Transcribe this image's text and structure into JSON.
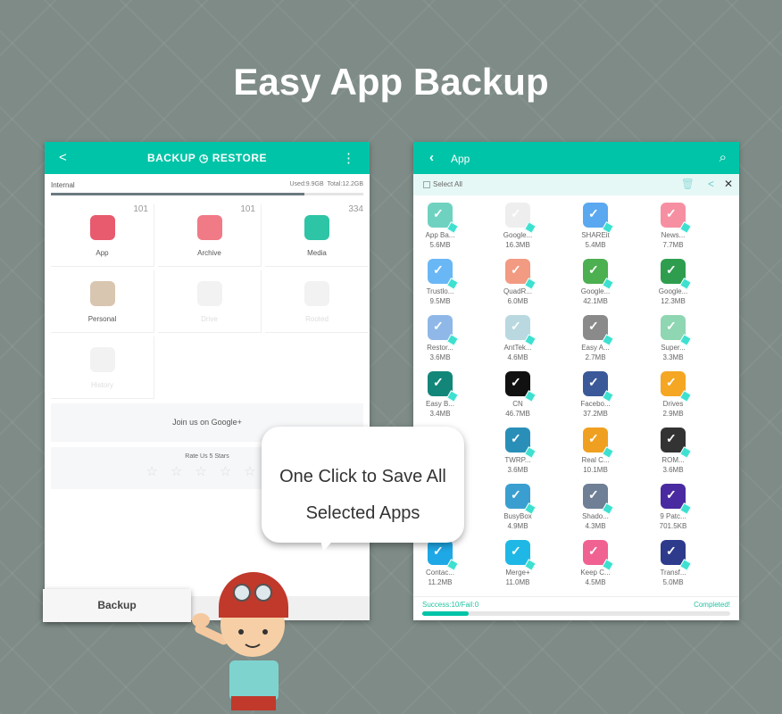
{
  "headline": "Easy App Backup",
  "left": {
    "title": "BACKUP ◷ RESTORE",
    "storage": {
      "label": "Internal",
      "used": "Used:9.9GB",
      "total": "Total:12.2GB",
      "used_fraction": 0.81
    },
    "categories": [
      {
        "label": "App",
        "count": "101",
        "color": "#e85a6e",
        "enabled": true
      },
      {
        "label": "Archive",
        "count": "101",
        "color": "#f07a86",
        "enabled": true
      },
      {
        "label": "Media",
        "count": "334",
        "color": "#2ec4a6",
        "enabled": true
      },
      {
        "label": "Personal",
        "count": "",
        "color": "#d9c6b0",
        "enabled": true
      },
      {
        "label": "Drive",
        "count": "",
        "color": "",
        "enabled": false
      },
      {
        "label": "Rooted",
        "count": "",
        "color": "",
        "enabled": false
      },
      {
        "label": "History",
        "count": "",
        "color": "",
        "enabled": false
      }
    ],
    "google_plus": "Join us on Google+",
    "rate": "Rate Us 5 Stars",
    "stars": "☆☆☆☆☆",
    "backup_button": "Backup"
  },
  "right": {
    "title": "App",
    "select_all": "Select All",
    "apps": [
      {
        "name": "App Ba...",
        "size": "5.6MB",
        "color": "#6fd2c0"
      },
      {
        "name": "Google...",
        "size": "16.3MB",
        "color": "#eeeeee"
      },
      {
        "name": "SHAREit",
        "size": "5.4MB",
        "color": "#5aa8f0"
      },
      {
        "name": "News...",
        "size": "7.7MB",
        "color": "#f78fa3"
      },
      {
        "name": "Trustlo...",
        "size": "9.5MB",
        "color": "#6ab7f5"
      },
      {
        "name": "QuadR...",
        "size": "6.0MB",
        "color": "#f29a82"
      },
      {
        "name": "Google...",
        "size": "42.1MB",
        "color": "#4caf50"
      },
      {
        "name": "Google...",
        "size": "12.3MB",
        "color": "#2e9e4e"
      },
      {
        "name": "Restor...",
        "size": "3.6MB",
        "color": "#8fb8e8"
      },
      {
        "name": "AntTek...",
        "size": "4.6MB",
        "color": "#b9d8e0"
      },
      {
        "name": "Easy A...",
        "size": "2.7MB",
        "color": "#8a8a8a"
      },
      {
        "name": "Super...",
        "size": "3.3MB",
        "color": "#8fd6b2"
      },
      {
        "name": "Easy B...",
        "size": "3.4MB",
        "color": "#13867a"
      },
      {
        "name": "CN",
        "size": "46.7MB",
        "color": "#111111"
      },
      {
        "name": "Facebo...",
        "size": "37.2MB",
        "color": "#3b5998"
      },
      {
        "name": "Drives",
        "size": "2.9MB",
        "color": "#f5a623"
      },
      {
        "name": "",
        "size": "",
        "color": ""
      },
      {
        "name": "TWRP...",
        "size": "3.6MB",
        "color": "#2a8fb8"
      },
      {
        "name": "Real C...",
        "size": "10.1MB",
        "color": "#f0a020"
      },
      {
        "name": "ROM...",
        "size": "3.6MB",
        "color": "#333333"
      },
      {
        "name": "",
        "size": "",
        "color": ""
      },
      {
        "name": "BusyBox",
        "size": "4.9MB",
        "color": "#3a9fd0"
      },
      {
        "name": "Shado...",
        "size": "4.3MB",
        "color": "#6e7f96"
      },
      {
        "name": "9 Patc...",
        "size": "701.5KB",
        "color": "#4a2aa0"
      },
      {
        "name": "Contac...",
        "size": "11.2MB",
        "color": "#1fa8e6"
      },
      {
        "name": "Merge+",
        "size": "11.0MB",
        "color": "#1fb8e6"
      },
      {
        "name": "Keep C...",
        "size": "4.5MB",
        "color": "#f06292"
      },
      {
        "name": "Transf...",
        "size": "5.0MB",
        "color": "#2e3a8c"
      }
    ],
    "status": "Success:10/Fail:0",
    "completed": "Completed!",
    "progress_fraction": 0.15
  },
  "bubble": {
    "line1": "One Click to Save All",
    "line2": "Selected Apps"
  },
  "colors": {
    "accent": "#00c4a7",
    "background": "#7e8b87"
  }
}
